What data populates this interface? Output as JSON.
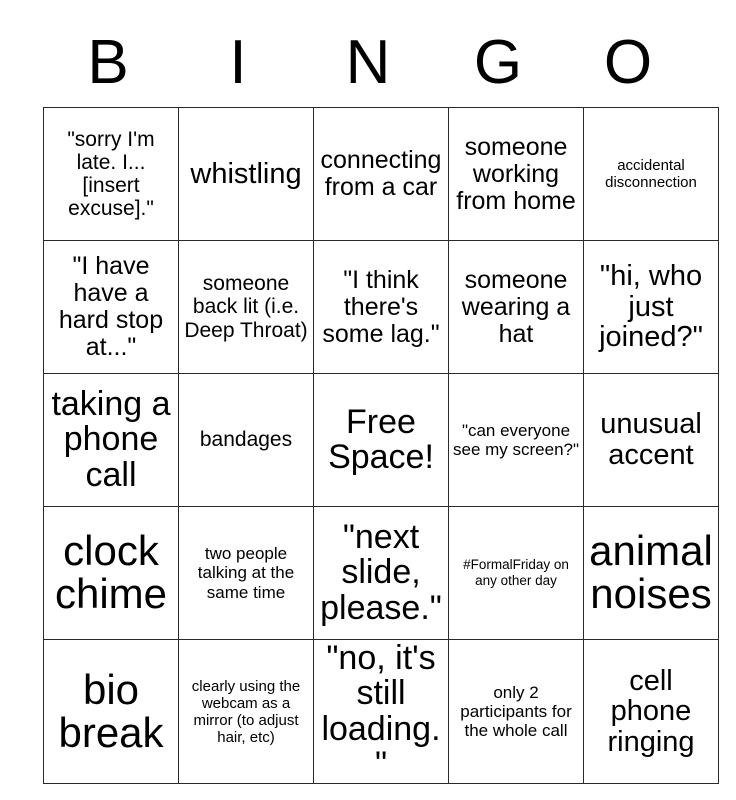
{
  "card": {
    "header_letters": [
      "B",
      "I",
      "N",
      "G",
      "O"
    ],
    "rows": [
      [
        {
          "text": "\"sorry I'm late. I... [insert excuse].\"",
          "size": "fs-m"
        },
        {
          "text": "whistling",
          "size": "fs-xl"
        },
        {
          "text": "connecting from a car",
          "size": "fs-l"
        },
        {
          "text": "someone working from home",
          "size": "fs-l"
        },
        {
          "text": "accidental disconnection",
          "size": "fs-xs"
        }
      ],
      [
        {
          "text": "\"I have have a hard stop at...\"",
          "size": "fs-l"
        },
        {
          "text": "someone back lit (i.e. Deep Throat)",
          "size": "fs-m"
        },
        {
          "text": "\"I think there's some lag.\"",
          "size": "fs-l"
        },
        {
          "text": "someone wearing a hat",
          "size": "fs-l"
        },
        {
          "text": "\"hi, who just joined?\"",
          "size": "fs-xl"
        }
      ],
      [
        {
          "text": "taking a phone call",
          "size": "fs-xxl"
        },
        {
          "text": "bandages",
          "size": "fs-m"
        },
        {
          "text": "Free Space!",
          "size": "fs-xxl"
        },
        {
          "text": "\"can everyone see my screen?\"",
          "size": "fs-s"
        },
        {
          "text": "unusual accent",
          "size": "fs-xl"
        }
      ],
      [
        {
          "text": "clock chime",
          "size": "fs-huge"
        },
        {
          "text": "two people talking at the same time",
          "size": "fs-s"
        },
        {
          "text": "\"next slide, please.\"",
          "size": "fs-xxl"
        },
        {
          "text": "#FormalFriday on any other day",
          "size": "fs-xxs"
        },
        {
          "text": "animal noises",
          "size": "fs-huge"
        }
      ],
      [
        {
          "text": "bio break",
          "size": "fs-huge"
        },
        {
          "text": "clearly using the webcam as a mirror (to adjust hair, etc)",
          "size": "fs-xs"
        },
        {
          "text": "\"no, it's still loading.\"",
          "size": "fs-xxl"
        },
        {
          "text": "only 2 participants for the whole call",
          "size": "fs-s"
        },
        {
          "text": "cell phone ringing",
          "size": "fs-xl"
        }
      ]
    ]
  },
  "colors": {
    "background": "#ffffff",
    "text": "#000000",
    "grid_line": "#2b2b2b"
  }
}
